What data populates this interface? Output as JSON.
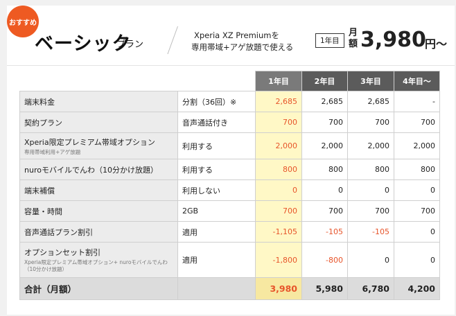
{
  "badge": "おすすめ",
  "header": {
    "title": "ベーシック",
    "subtitle": "プラン",
    "desc_line1": "Xperia XZ Premiumを",
    "desc_line2": "専用帯域+アゲ放題で使える",
    "year_label": "1年目",
    "month_label": "月額",
    "price": "3,980",
    "price_unit": "円〜"
  },
  "table": {
    "columns": [
      "1年目",
      "2年目",
      "3年目",
      "4年目〜"
    ],
    "rows": [
      {
        "item": "端末料金",
        "note": "",
        "cond": "分割（36回）※",
        "values": [
          "2,685",
          "2,685",
          "2,685",
          "-"
        ],
        "neg": [
          false,
          false,
          false,
          false
        ]
      },
      {
        "item": "契約プラン",
        "note": "",
        "cond": "音声通話付き",
        "values": [
          "700",
          "700",
          "700",
          "700"
        ],
        "neg": [
          false,
          false,
          false,
          false
        ]
      },
      {
        "item": "Xperia限定プレミアム帯域オプション",
        "note": "専用帯域利用+アゲ放題",
        "cond": "利用する",
        "values": [
          "2,000",
          "2,000",
          "2,000",
          "2,000"
        ],
        "neg": [
          false,
          false,
          false,
          false
        ]
      },
      {
        "item": "nuroモバイルでんわ（10分かけ放題）",
        "note": "",
        "cond": "利用する",
        "values": [
          "800",
          "800",
          "800",
          "800"
        ],
        "neg": [
          false,
          false,
          false,
          false
        ]
      },
      {
        "item": "端末補償",
        "note": "",
        "cond": "利用しない",
        "values": [
          "0",
          "0",
          "0",
          "0"
        ],
        "neg": [
          false,
          false,
          false,
          false
        ]
      },
      {
        "item": "容量・時間",
        "note": "",
        "cond": "2GB",
        "values": [
          "700",
          "700",
          "700",
          "700"
        ],
        "neg": [
          false,
          false,
          false,
          false
        ]
      },
      {
        "item": "音声通話プラン割引",
        "note": "",
        "cond": "適用",
        "values": [
          "-1,105",
          "-105",
          "-105",
          "0"
        ],
        "neg": [
          true,
          true,
          true,
          false
        ]
      },
      {
        "item": "オプションセット割引",
        "note": "Xperia限定プレミアム帯域オプション+ nuroモバイルでんわ（10分かけ放題）",
        "cond": "適用",
        "values": [
          "-1,800",
          "-800",
          "0",
          "0"
        ],
        "neg": [
          true,
          true,
          false,
          false
        ]
      }
    ],
    "total": {
      "item": "合計（月額）",
      "values": [
        "3,980",
        "5,980",
        "6,780",
        "4,200"
      ]
    }
  }
}
